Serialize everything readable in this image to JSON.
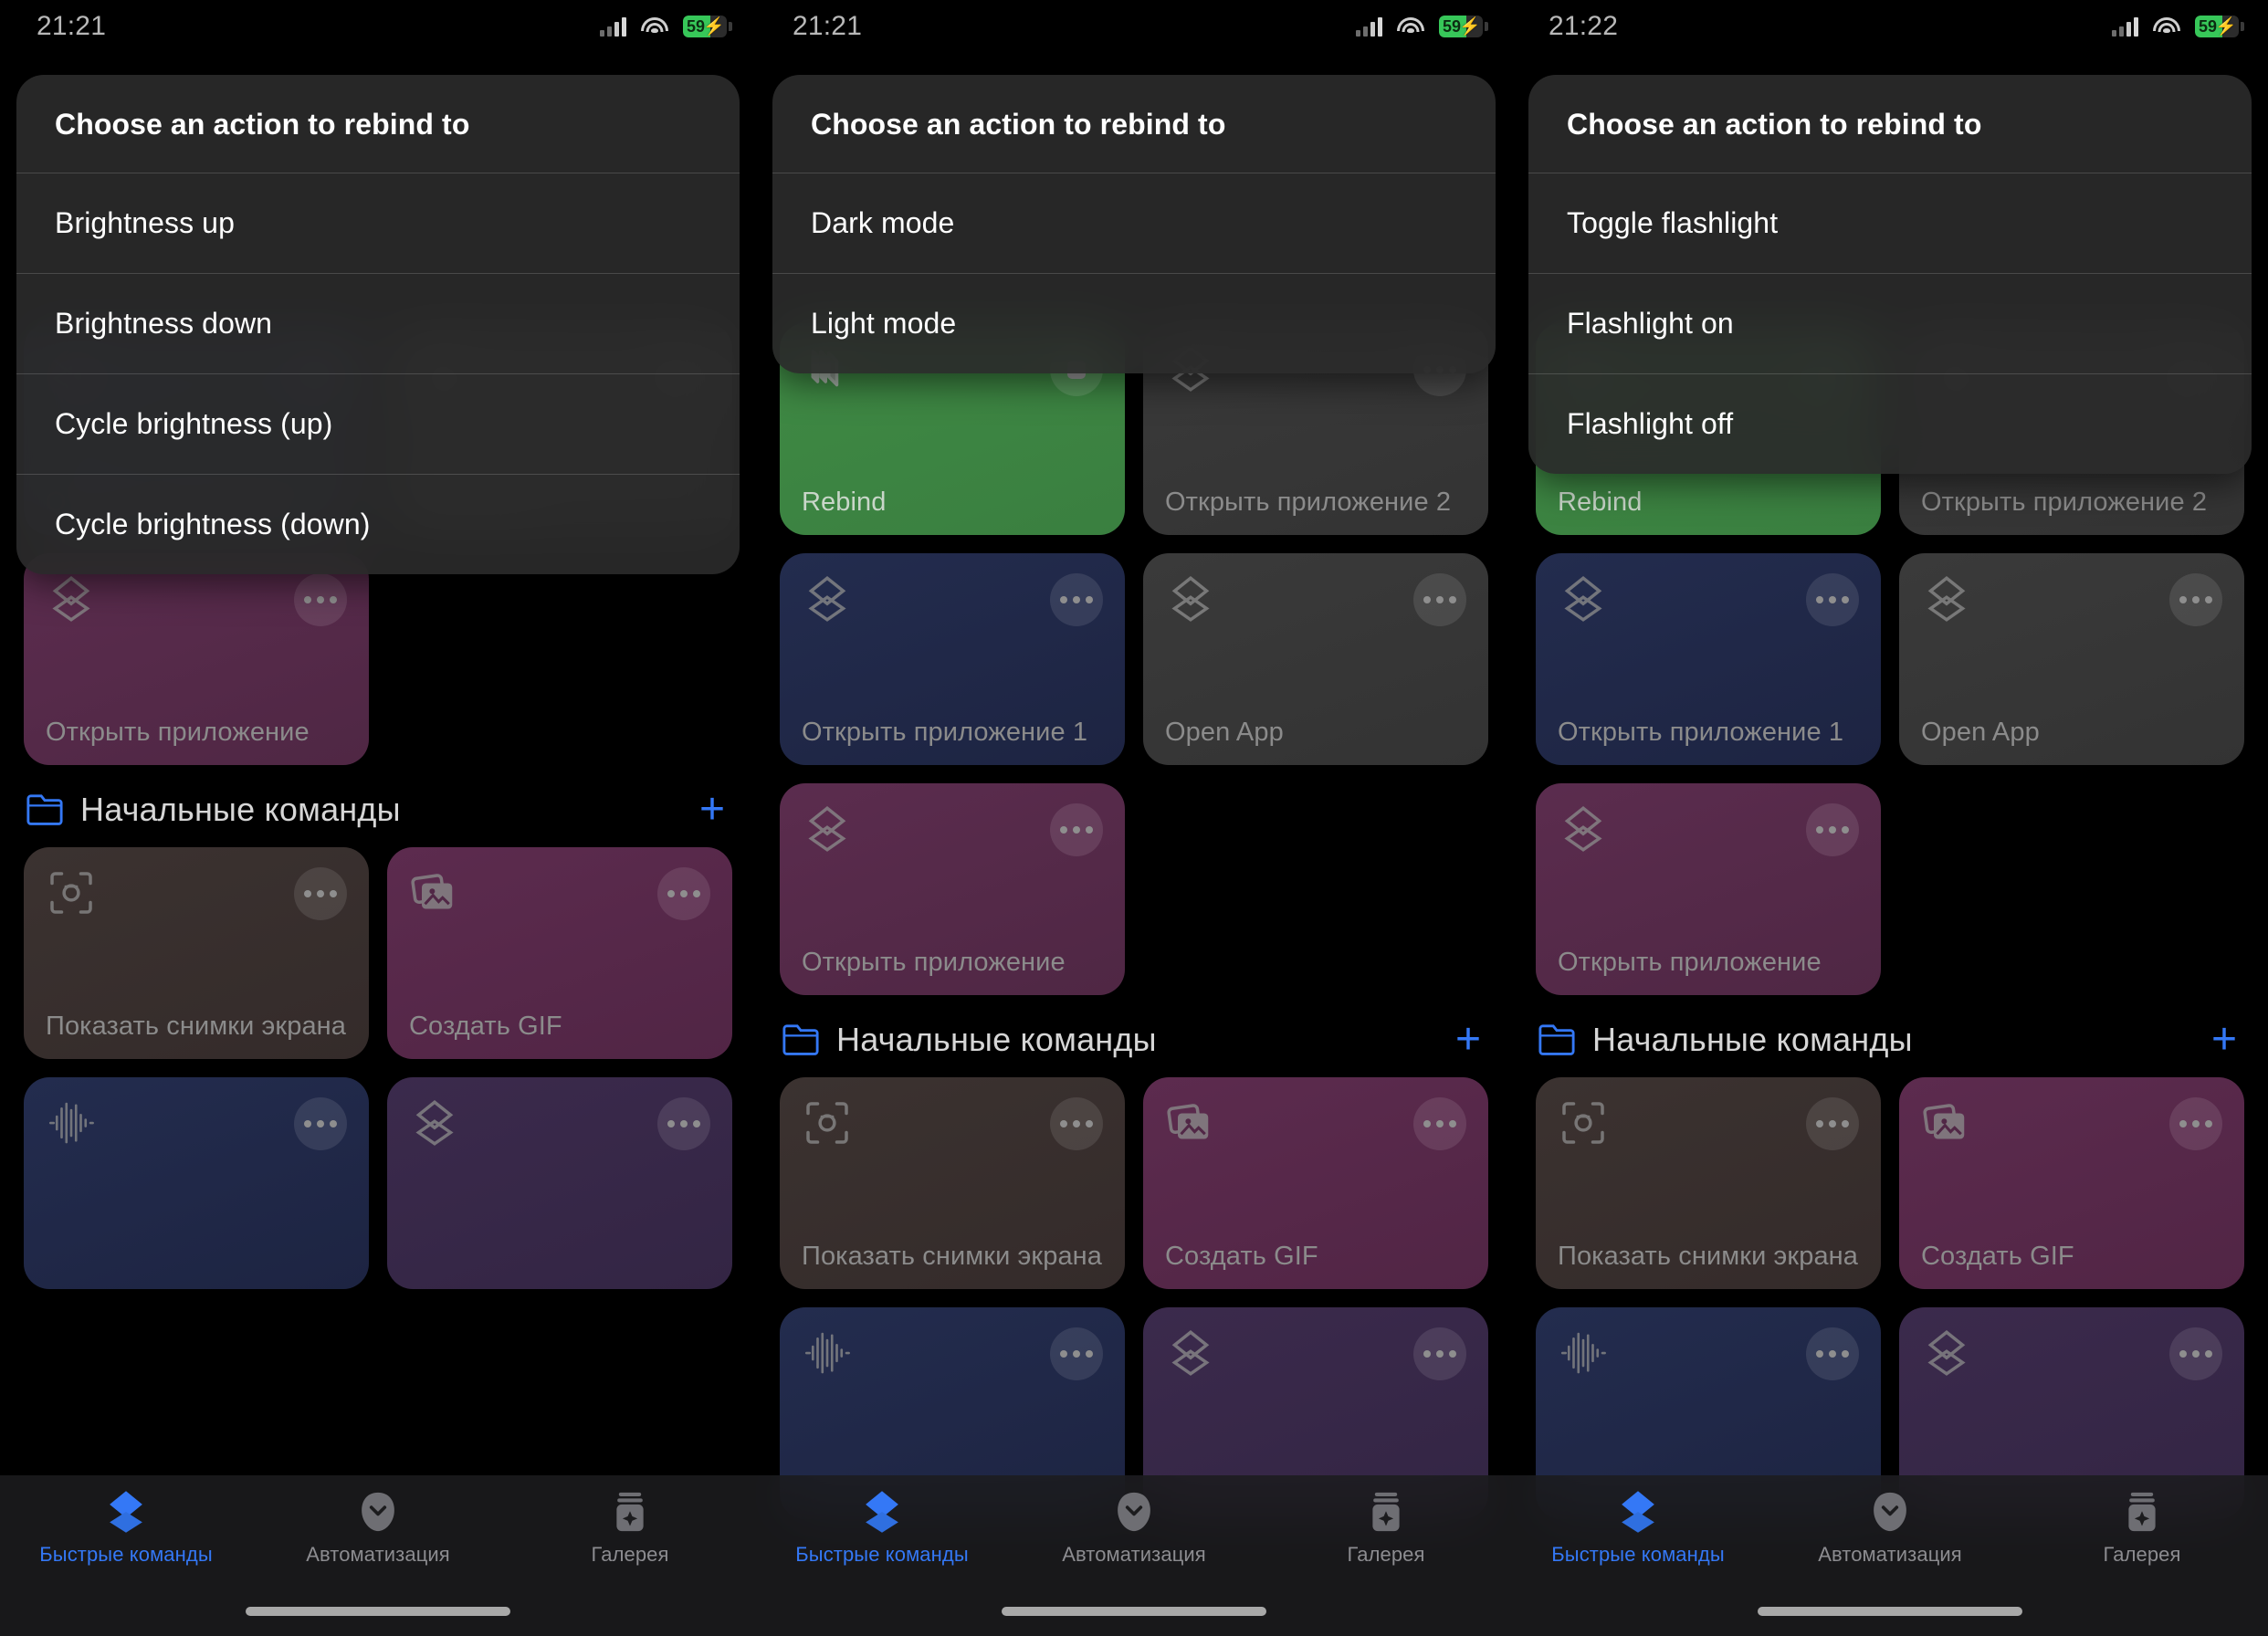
{
  "app": {
    "name": "Быстрые команды",
    "sheet_title": "Choose an action to rebind to"
  },
  "status_bar": {
    "battery_percent": "59",
    "charging_glyph": "⚡",
    "signal_icon": "cellular-signal-icon",
    "wifi_icon": "wifi-icon",
    "battery_icon": "battery-icon"
  },
  "panels": [
    {
      "id": "panel-1",
      "time": "21:21",
      "sheet": {
        "title": "Choose an action to rebind to",
        "items": [
          "Brightness up",
          "Brightness down",
          "Cycle brightness (up)",
          "Cycle brightness (down)"
        ]
      }
    },
    {
      "id": "panel-2",
      "time": "21:21",
      "sheet": {
        "title": "Choose an action to rebind to",
        "items": [
          "Dark mode",
          "Light mode"
        ]
      }
    },
    {
      "id": "panel-3",
      "time": "21:22",
      "sheet": {
        "title": "Choose an action to rebind to",
        "items": [
          "Toggle flashlight",
          "Flashlight on",
          "Flashlight off"
        ]
      }
    }
  ],
  "shortcuts": {
    "row_rebind": [
      {
        "label": "Rebind",
        "color": "green",
        "icon": "stacked-cards-icon",
        "menu": "square-menu-icon"
      },
      {
        "label": "Открыть приложение 2",
        "color": "gray",
        "icon": "shortcuts-layers-icon",
        "menu": "ellipsis-menu-icon"
      }
    ],
    "row_open_app": [
      {
        "label": "Открыть приложение 1",
        "color": "blue",
        "icon": "shortcuts-layers-icon",
        "menu": "ellipsis-menu-icon"
      },
      {
        "label": "Open App",
        "color": "gray",
        "icon": "shortcuts-layers-icon",
        "menu": "ellipsis-menu-icon"
      }
    ],
    "row_open_app_purple": [
      {
        "label": "Открыть приложение",
        "color": "purple",
        "icon": "shortcuts-layers-icon",
        "menu": "ellipsis-menu-icon"
      }
    ]
  },
  "folder": {
    "icon": "folder-icon",
    "title": "Начальные команды",
    "add_label": "+",
    "tiles": [
      {
        "label": "Показать снимки экрана",
        "color": "brown",
        "icon": "screenshot-camera-icon",
        "menu": "ellipsis-menu-icon"
      },
      {
        "label": "Создать GIF",
        "color": "plum",
        "icon": "photos-stack-icon",
        "menu": "ellipsis-menu-icon"
      },
      {
        "label": "",
        "color": "navy",
        "icon": "waveform-icon",
        "menu": "ellipsis-menu-icon"
      },
      {
        "label": "",
        "color": "violet",
        "icon": "shortcuts-layers-icon",
        "menu": "ellipsis-menu-icon"
      }
    ]
  },
  "tabbar": {
    "items": [
      {
        "label": "Быстрые команды",
        "icon": "shortcuts-layers-icon",
        "active": true
      },
      {
        "label": "Автоматизация",
        "icon": "automation-clock-icon",
        "active": false
      },
      {
        "label": "Галерея",
        "icon": "gallery-jar-icon",
        "active": false
      }
    ]
  },
  "colors": {
    "accent_blue": "#3478f6",
    "rebind_green": "#3f8a44",
    "battery_green": "#37c759"
  }
}
